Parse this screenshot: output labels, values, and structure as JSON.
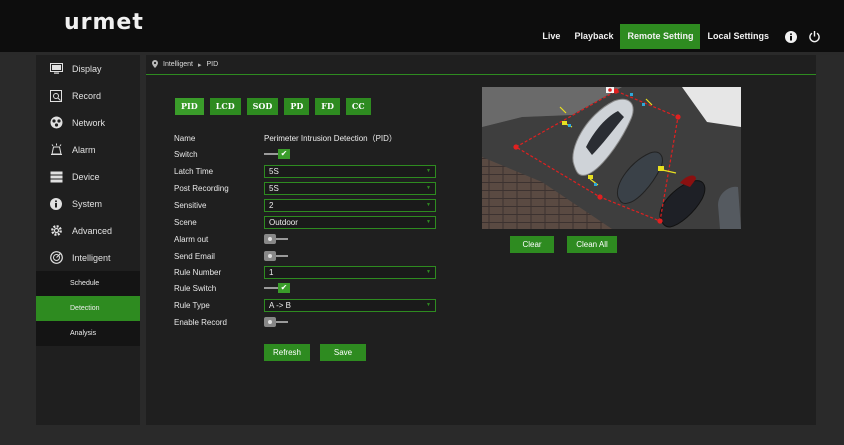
{
  "app": {
    "logo": "urmet"
  },
  "nav": {
    "items": [
      {
        "label": "Live",
        "active": false
      },
      {
        "label": "Playback",
        "active": false
      },
      {
        "label": "Remote Setting",
        "active": true
      },
      {
        "label": "Local Settings",
        "active": false
      }
    ],
    "icons": [
      "info-icon",
      "power-icon"
    ]
  },
  "sidebar": {
    "items": [
      {
        "label": "Display",
        "icon": "monitor-icon"
      },
      {
        "label": "Record",
        "icon": "record-icon"
      },
      {
        "label": "Network",
        "icon": "network-icon"
      },
      {
        "label": "Alarm",
        "icon": "alarm-icon"
      },
      {
        "label": "Device",
        "icon": "device-icon"
      },
      {
        "label": "System",
        "icon": "info-icon"
      },
      {
        "label": "Advanced",
        "icon": "gear-icon"
      },
      {
        "label": "Intelligent",
        "icon": "intelligent-icon"
      }
    ],
    "subitems": [
      {
        "label": "Schedule",
        "active": false
      },
      {
        "label": "Detection",
        "active": true
      },
      {
        "label": "Analysis",
        "active": false
      }
    ]
  },
  "breadcrumb": {
    "section": "Intelligent",
    "page": "PID"
  },
  "tabs": [
    "PID",
    "LCD",
    "SOD",
    "PD",
    "FD",
    "CC"
  ],
  "active_tab": "PID",
  "form": {
    "name": {
      "label": "Name",
      "value": "Perimeter Intrusion Detection（PID）"
    },
    "switch": {
      "label": "Switch",
      "on": true
    },
    "latch_time": {
      "label": "Latch Time",
      "value": "5S"
    },
    "post_recording": {
      "label": "Post Recording",
      "value": "5S"
    },
    "sensitive": {
      "label": "Sensitive",
      "value": "2"
    },
    "scene": {
      "label": "Scene",
      "value": "Outdoor"
    },
    "alarm_out": {
      "label": "Alarm out",
      "on": false
    },
    "send_email": {
      "label": "Send Email",
      "on": false
    },
    "rule_number": {
      "label": "Rule Number",
      "value": "1"
    },
    "rule_switch": {
      "label": "Rule Switch",
      "on": true
    },
    "rule_type": {
      "label": "Rule Type",
      "value": "A -> B"
    },
    "enable_record": {
      "label": "Enable Record",
      "on": false
    }
  },
  "buttons": {
    "refresh": "Refresh",
    "save": "Save",
    "clear": "Clear",
    "clean_all": "Clean All"
  },
  "colors": {
    "accent": "#2e8b20",
    "rule_line": "#e02020",
    "marker": "#e8e020"
  }
}
